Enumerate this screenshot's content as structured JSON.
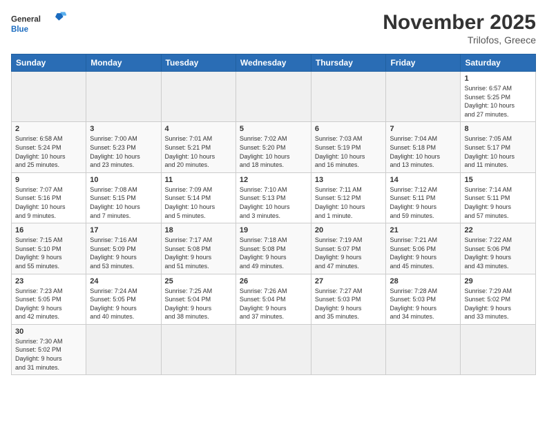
{
  "header": {
    "logo_general": "General",
    "logo_blue": "Blue",
    "month_year": "November 2025",
    "location": "Trilofos, Greece"
  },
  "weekdays": [
    "Sunday",
    "Monday",
    "Tuesday",
    "Wednesday",
    "Thursday",
    "Friday",
    "Saturday"
  ],
  "weeks": [
    [
      {
        "day": "",
        "info": ""
      },
      {
        "day": "",
        "info": ""
      },
      {
        "day": "",
        "info": ""
      },
      {
        "day": "",
        "info": ""
      },
      {
        "day": "",
        "info": ""
      },
      {
        "day": "",
        "info": ""
      },
      {
        "day": "1",
        "info": "Sunrise: 6:57 AM\nSunset: 5:25 PM\nDaylight: 10 hours\nand 27 minutes."
      }
    ],
    [
      {
        "day": "2",
        "info": "Sunrise: 6:58 AM\nSunset: 5:24 PM\nDaylight: 10 hours\nand 25 minutes."
      },
      {
        "day": "3",
        "info": "Sunrise: 7:00 AM\nSunset: 5:23 PM\nDaylight: 10 hours\nand 23 minutes."
      },
      {
        "day": "4",
        "info": "Sunrise: 7:01 AM\nSunset: 5:21 PM\nDaylight: 10 hours\nand 20 minutes."
      },
      {
        "day": "5",
        "info": "Sunrise: 7:02 AM\nSunset: 5:20 PM\nDaylight: 10 hours\nand 18 minutes."
      },
      {
        "day": "6",
        "info": "Sunrise: 7:03 AM\nSunset: 5:19 PM\nDaylight: 10 hours\nand 16 minutes."
      },
      {
        "day": "7",
        "info": "Sunrise: 7:04 AM\nSunset: 5:18 PM\nDaylight: 10 hours\nand 13 minutes."
      },
      {
        "day": "8",
        "info": "Sunrise: 7:05 AM\nSunset: 5:17 PM\nDaylight: 10 hours\nand 11 minutes."
      }
    ],
    [
      {
        "day": "9",
        "info": "Sunrise: 7:07 AM\nSunset: 5:16 PM\nDaylight: 10 hours\nand 9 minutes."
      },
      {
        "day": "10",
        "info": "Sunrise: 7:08 AM\nSunset: 5:15 PM\nDaylight: 10 hours\nand 7 minutes."
      },
      {
        "day": "11",
        "info": "Sunrise: 7:09 AM\nSunset: 5:14 PM\nDaylight: 10 hours\nand 5 minutes."
      },
      {
        "day": "12",
        "info": "Sunrise: 7:10 AM\nSunset: 5:13 PM\nDaylight: 10 hours\nand 3 minutes."
      },
      {
        "day": "13",
        "info": "Sunrise: 7:11 AM\nSunset: 5:12 PM\nDaylight: 10 hours\nand 1 minute."
      },
      {
        "day": "14",
        "info": "Sunrise: 7:12 AM\nSunset: 5:11 PM\nDaylight: 9 hours\nand 59 minutes."
      },
      {
        "day": "15",
        "info": "Sunrise: 7:14 AM\nSunset: 5:11 PM\nDaylight: 9 hours\nand 57 minutes."
      }
    ],
    [
      {
        "day": "16",
        "info": "Sunrise: 7:15 AM\nSunset: 5:10 PM\nDaylight: 9 hours\nand 55 minutes."
      },
      {
        "day": "17",
        "info": "Sunrise: 7:16 AM\nSunset: 5:09 PM\nDaylight: 9 hours\nand 53 minutes."
      },
      {
        "day": "18",
        "info": "Sunrise: 7:17 AM\nSunset: 5:08 PM\nDaylight: 9 hours\nand 51 minutes."
      },
      {
        "day": "19",
        "info": "Sunrise: 7:18 AM\nSunset: 5:08 PM\nDaylight: 9 hours\nand 49 minutes."
      },
      {
        "day": "20",
        "info": "Sunrise: 7:19 AM\nSunset: 5:07 PM\nDaylight: 9 hours\nand 47 minutes."
      },
      {
        "day": "21",
        "info": "Sunrise: 7:21 AM\nSunset: 5:06 PM\nDaylight: 9 hours\nand 45 minutes."
      },
      {
        "day": "22",
        "info": "Sunrise: 7:22 AM\nSunset: 5:06 PM\nDaylight: 9 hours\nand 43 minutes."
      }
    ],
    [
      {
        "day": "23",
        "info": "Sunrise: 7:23 AM\nSunset: 5:05 PM\nDaylight: 9 hours\nand 42 minutes."
      },
      {
        "day": "24",
        "info": "Sunrise: 7:24 AM\nSunset: 5:05 PM\nDaylight: 9 hours\nand 40 minutes."
      },
      {
        "day": "25",
        "info": "Sunrise: 7:25 AM\nSunset: 5:04 PM\nDaylight: 9 hours\nand 38 minutes."
      },
      {
        "day": "26",
        "info": "Sunrise: 7:26 AM\nSunset: 5:04 PM\nDaylight: 9 hours\nand 37 minutes."
      },
      {
        "day": "27",
        "info": "Sunrise: 7:27 AM\nSunset: 5:03 PM\nDaylight: 9 hours\nand 35 minutes."
      },
      {
        "day": "28",
        "info": "Sunrise: 7:28 AM\nSunset: 5:03 PM\nDaylight: 9 hours\nand 34 minutes."
      },
      {
        "day": "29",
        "info": "Sunrise: 7:29 AM\nSunset: 5:02 PM\nDaylight: 9 hours\nand 33 minutes."
      }
    ],
    [
      {
        "day": "30",
        "info": "Sunrise: 7:30 AM\nSunset: 5:02 PM\nDaylight: 9 hours\nand 31 minutes."
      },
      {
        "day": "",
        "info": ""
      },
      {
        "day": "",
        "info": ""
      },
      {
        "day": "",
        "info": ""
      },
      {
        "day": "",
        "info": ""
      },
      {
        "day": "",
        "info": ""
      },
      {
        "day": "",
        "info": ""
      }
    ]
  ]
}
